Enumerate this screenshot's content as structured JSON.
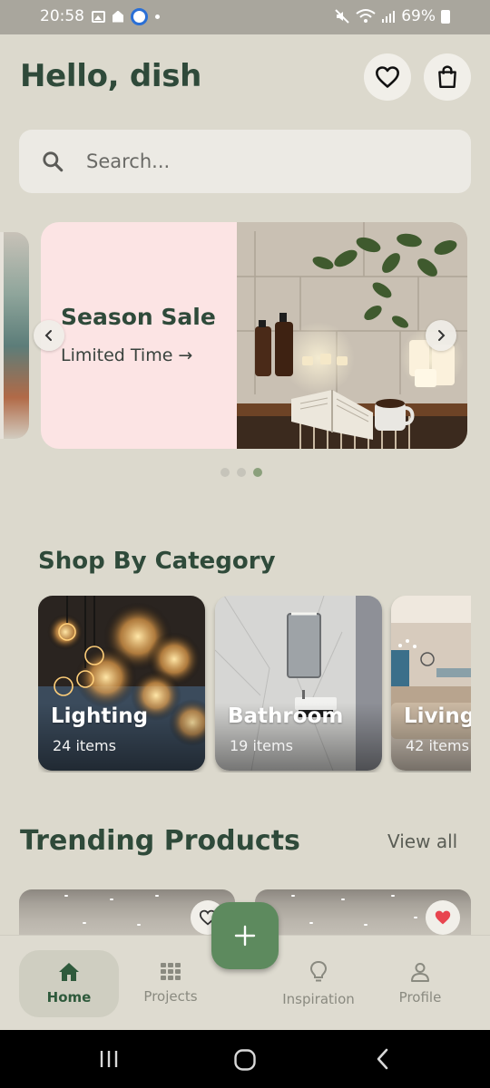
{
  "status_bar": {
    "time": "20:58",
    "battery": "69%"
  },
  "header": {
    "greeting": "Hello, dish"
  },
  "search": {
    "placeholder": "Search..."
  },
  "banner": {
    "title": "Season Sale",
    "subtitle": "Limited Time →"
  },
  "sections": {
    "categories_title": "Shop By Category",
    "trending_title": "Trending Products",
    "view_all": "View all"
  },
  "categories": [
    {
      "name": "Lighting",
      "count": "24 items"
    },
    {
      "name": "Bathroom",
      "count": "19 items"
    },
    {
      "name": "Living",
      "count": "42 items"
    }
  ],
  "products": [
    {
      "favorited": false
    },
    {
      "favorited": true
    }
  ],
  "nav": {
    "home": "Home",
    "projects": "Projects",
    "inspiration": "Inspiration",
    "profile": "Profile"
  },
  "colors": {
    "accent": "#5d8a5e",
    "heading": "#2f4a3a",
    "background": "#dcd9cd",
    "banner_bg": "#fce4e4",
    "favorite_red": "#e8454f"
  }
}
